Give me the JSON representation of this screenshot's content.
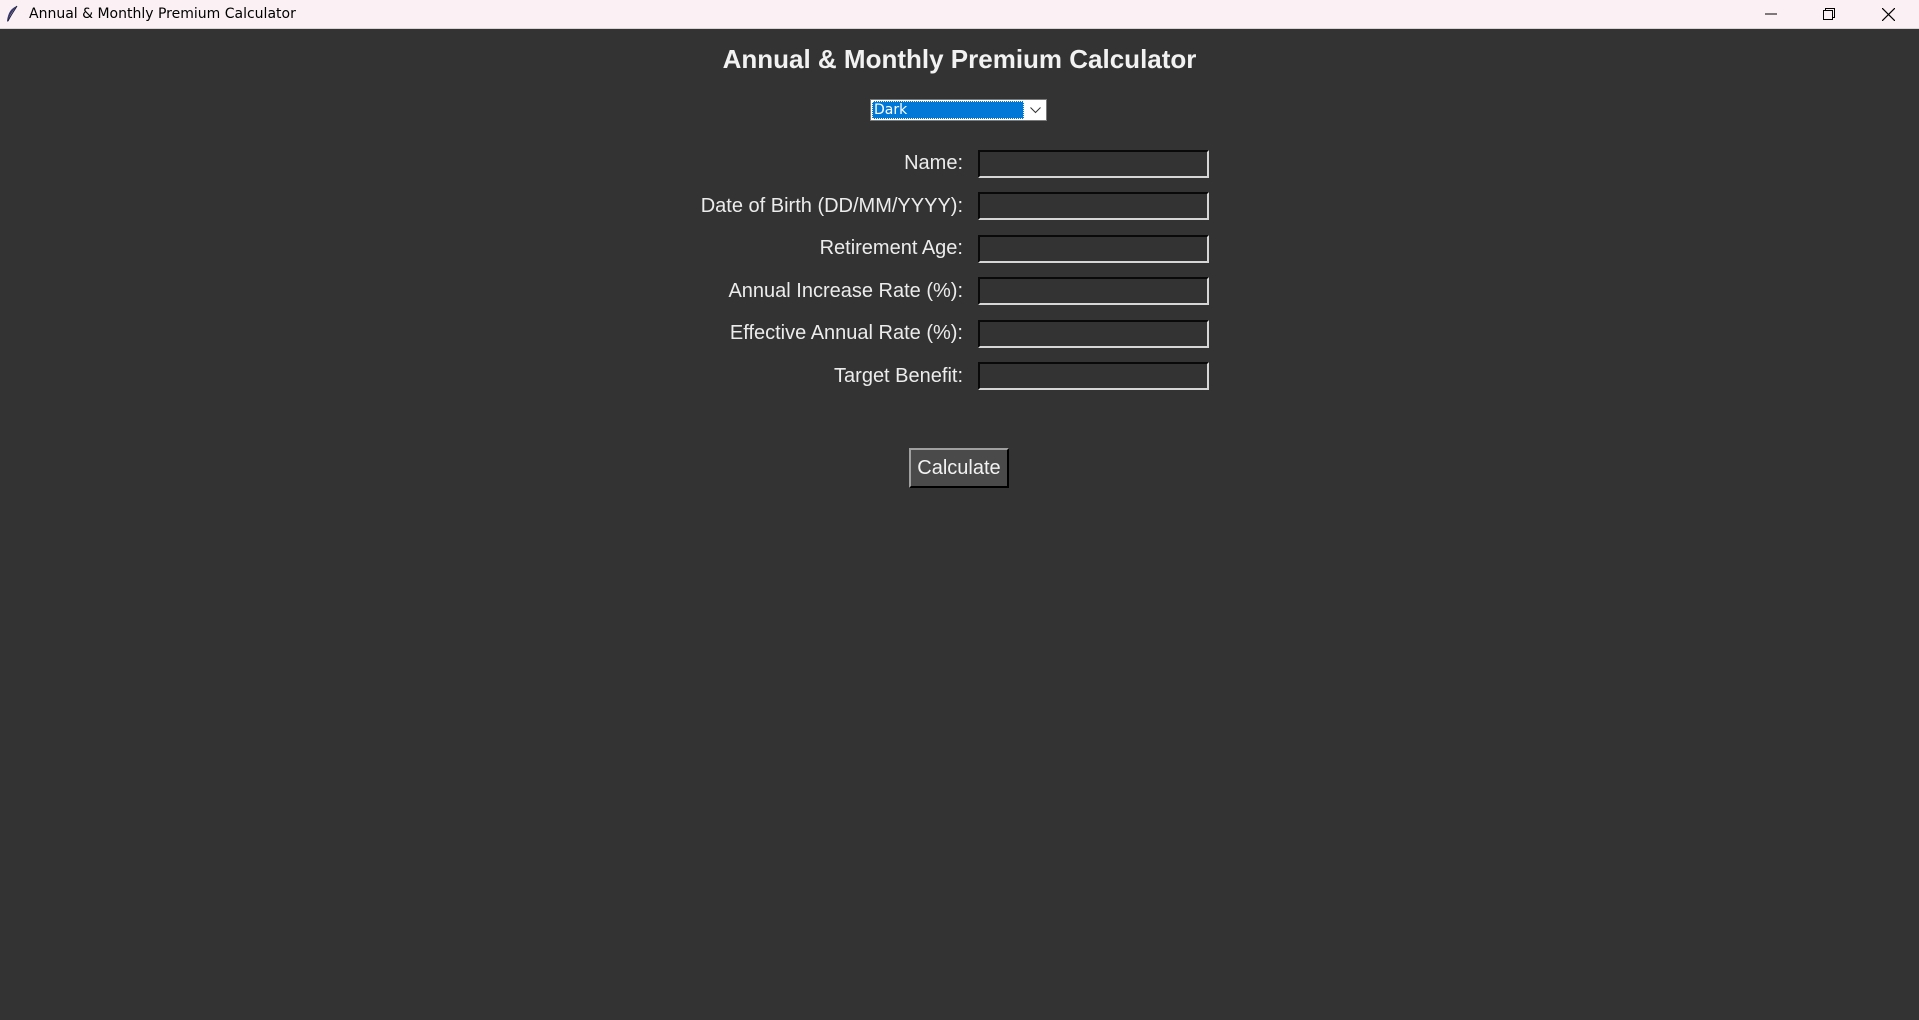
{
  "window": {
    "title": "Annual & Monthly Premium Calculator",
    "icon": "feather-icon",
    "controls": [
      "minimize-icon",
      "restore-icon",
      "close-icon"
    ]
  },
  "main": {
    "heading": "Annual & Monthly Premium Calculator",
    "theme_select": {
      "value": "Dark"
    },
    "form": {
      "fields": [
        {
          "label": "Name:",
          "value": ""
        },
        {
          "label": "Date of Birth (DD/MM/YYYY):",
          "value": ""
        },
        {
          "label": "Retirement Age:",
          "value": ""
        },
        {
          "label": "Annual Increase Rate (%):",
          "value": ""
        },
        {
          "label": "Effective Annual Rate (%):",
          "value": ""
        },
        {
          "label": "Target Benefit:",
          "value": ""
        }
      ]
    },
    "calculate_label": "Calculate"
  },
  "colors": {
    "background": "#333333",
    "titlebar": "#fbf1f4",
    "selection": "#0078d7",
    "text": "#ececec",
    "button": "#4a4a4a"
  }
}
